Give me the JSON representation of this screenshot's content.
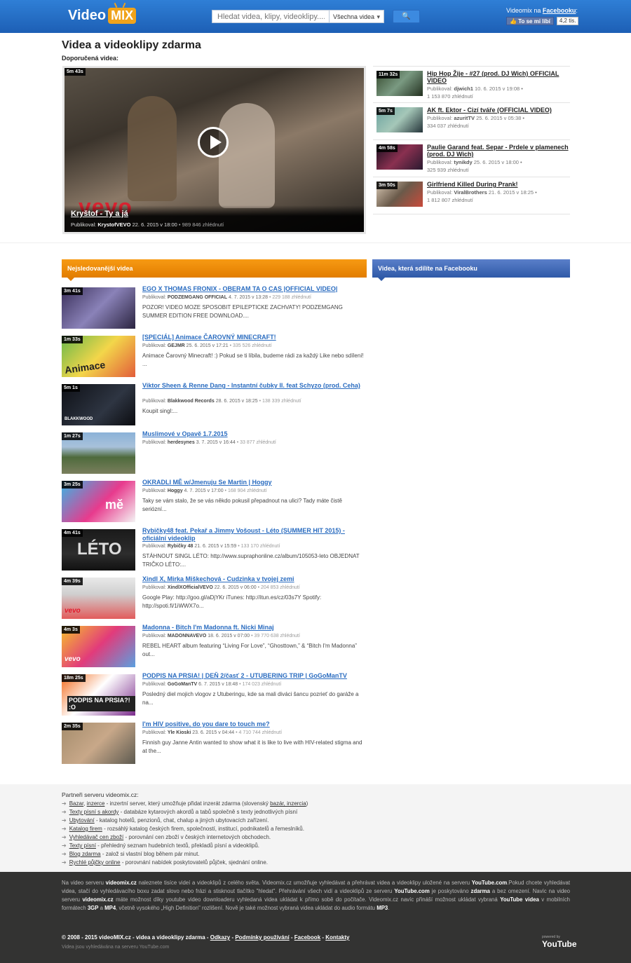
{
  "header": {
    "logo_video": "Video",
    "logo_mix": "MIX",
    "search_placeholder": "Hledat videa, klipy, videoklipy....",
    "search_select": "Všechna videa",
    "fb_text": "Videomix na",
    "fb_link": "Facebooku",
    "fb_colon": ":",
    "fb_like": "To se mi líbí",
    "fb_count": "4,2 tis."
  },
  "page": {
    "title": "Videa a videoklipy zdarma",
    "recommended": "Doporučená videa:"
  },
  "featured": {
    "duration": "5m 43s",
    "title": "Kryštof - Ty a já",
    "published_label": "Publikoval:",
    "author": "KrystofVEVO",
    "date": "22. 6. 2015 v 18:00",
    "views": "989 846 zhlédnutí",
    "overlay": "vevo"
  },
  "side_videos": [
    {
      "duration": "11m 32s",
      "title": "Hip Hop Žije - #27 (prod. DJ Wich) OFFICIAL VIDEO",
      "published_label": "Publikoval:",
      "author": "djwich1",
      "date": "10. 6. 2015 v 19:08",
      "views": "1 153 870 zhlédnutí"
    },
    {
      "duration": "5m 7s",
      "title": "AK ft. Ektor - Cizí tváře (OFFICIAL VIDEO)",
      "published_label": "Publikoval:",
      "author": "azuritTV",
      "date": "25. 6. 2015 v 05:38",
      "views": "334 037 zhlédnutí"
    },
    {
      "duration": "4m 58s",
      "title": "Paulie Garand feat. Separ - Prdele v plamenech (prod. DJ Wich)",
      "published_label": "Publikoval:",
      "author": "tynikdy",
      "date": "25. 6. 2015 v 18:00",
      "views": "325 939 zhlédnutí"
    },
    {
      "duration": "3m 50s",
      "title": "Girlfriend Killed During Prank!",
      "published_label": "Publikoval:",
      "author": "ViralBrothers",
      "date": "21. 6. 2015 v 18:25",
      "views": "1 812 807 zhlédnutí"
    }
  ],
  "sections": {
    "most_watched": "Nejsledovanější videa",
    "facebook": "Videa, která sdílíte na Facebooku"
  },
  "videos": [
    {
      "duration": "3m 41s",
      "title": "EGO X THOMAS FRONIX - OBERAM TA O CAS |OFFICIAL VIDEO|",
      "published_label": "Publikoval:",
      "author": "PODZEMGANG OFFICIAL",
      "date": "4. 7. 2015 v 13:28",
      "views": "229 188 zhlédnutí",
      "desc": "POZOR! VIDEO MOZE SPOSOBIT EPILEPTICKE ZACHVATY! PODZEMGANG SUMMER EDITION FREE DOWNLOAD....",
      "thumb_label": ""
    },
    {
      "duration": "1m 33s",
      "title": "[SPECIÁL] Animace ČAROVNÝ MINECRAFT!",
      "published_label": "Publikoval:",
      "author": "GEJMR",
      "date": "25. 6. 2015 v 17:21",
      "views": "335 526 zhlédnutí",
      "desc": "Animace Čarovný Minecraft! :) Pokud se ti líbila, budeme rádi za každý Like nebo sdílení! ...",
      "thumb_label": "Animace"
    },
    {
      "duration": "5m 1s",
      "title": "Viktor Sheen & Renne Dang - Instantní čubky II. feat Schyzo (prod. Ceha)",
      "published_label": "Publikoval:",
      "author": "Blakkwood Records",
      "date": "28. 6. 2015 v 18:25",
      "views": "138 339 zhlédnutí",
      "desc": "Koupit singl:...",
      "thumb_label": "BLAKKWOOD"
    },
    {
      "duration": "1m 27s",
      "title": "Muslimové v Opavě 1.7.2015",
      "published_label": "Publikoval:",
      "author": "herdesynes",
      "date": "3. 7. 2015 v 16:44",
      "views": "33 877 zhlédnutí",
      "desc": "",
      "thumb_label": ""
    },
    {
      "duration": "3m 25s",
      "title": "OKRADLI MĚ w/Jmenuju Se Martin | Hoggy",
      "published_label": "Publikoval:",
      "author": "Hoggy",
      "date": "4. 7. 2015 v 17:00",
      "views": "168 904 zhlédnutí",
      "desc": "Taky se vám stalo, že se vás někdo pokusil přepadnout na ulici? Tady máte čistě seriózní...",
      "thumb_label": "mě"
    },
    {
      "duration": "4m 41s",
      "title": "Rybičky48 feat. Pekař a Jimmy Vošoust - Léto (SUMMER HIT 2015) - oficiální videoklip",
      "published_label": "Publikoval:",
      "author": "Rybičky 48",
      "date": "21. 6. 2015 v 15:59",
      "views": "133 170 zhlédnutí",
      "desc": "STÁHNOUT SINGL LÉTO: http://www.supraphonline.cz/album/105053-leto OBJEDNAT TRIČKO LÉTO:...",
      "thumb_label": "LÉTO"
    },
    {
      "duration": "4m 39s",
      "title": "Xindl X, Mirka Miškechová - Cudzinka v tvojej zemi",
      "published_label": "Publikoval:",
      "author": "XindlXOfficialVEVO",
      "date": "22. 6. 2015 v 06:00",
      "views": "204 853 zhlédnutí",
      "desc": "Google Play: http://goo.gl/aDjYKr iTunes: http://itun.es/cz/03s7Y Spotify: http://spoti.fi/1iWWX7o...",
      "thumb_label": "vevo"
    },
    {
      "duration": "4m 3s",
      "title": "Madonna - Bitch I'm Madonna ft. Nicki Minaj",
      "published_label": "Publikoval:",
      "author": "MADONNAVEVO",
      "date": "18. 6. 2015 v 07:00",
      "views": "39 770 638 zhlédnutí",
      "desc": "REBEL HEART album featuring “Living For Love”, “Ghosttown,” & “Bitch I'm Madonna” out...",
      "thumb_label": "vevo"
    },
    {
      "duration": "18m 25s",
      "title": "PODPIS NA PRSIA! | DEŇ 2/časť 2 - UTUBERING TRIP | GoGoManTV",
      "published_label": "Publikoval:",
      "author": "GoGoManTV",
      "date": "6. 7. 2015 v 18:48",
      "views": "174 023 zhlédnutí",
      "desc": "Posledný diel mojich vlogov z Utuberingu, kde sa mali diváci šancu pozrieť do garáže a na...",
      "thumb_label": "PODPIS NA PRSIA?! :O"
    },
    {
      "duration": "2m 35s",
      "title": "I'm HIV positive, do you dare to touch me?",
      "published_label": "Publikoval:",
      "author": "Yle Kioski",
      "date": "23. 6. 2015 v 04:44",
      "views": "4 710 744 zhlédnutí",
      "desc": "Finnish guy Janne Antin wanted to show what it is like to live with HIV-related stigma and at the...",
      "thumb_label": ""
    }
  ],
  "partners": {
    "title": "Partneři serveru videomix.cz:",
    "items": [
      {
        "link": "Bazar",
        "sep": ", ",
        "link2": "inzerce",
        "text": " - inzertní server, který umožňuje přidat inzerát zdarma (slovenský ",
        "link3": "bazár, inzercia",
        "text2": ")"
      },
      {
        "link": "Texty písní s akordy",
        "text": " - databáze kytarových akordů a tabů společně s texty jednotlivých písní"
      },
      {
        "link": "Ubytování",
        "text": " - katalog hotelů, penzionů, chat, chalup a jiných ubytovacích zařízení."
      },
      {
        "link": "Katalog firem",
        "text": " - rozsáhlý katalog českých firem, společností, institucí, podnikatelů a řemeslníků."
      },
      {
        "link": "Vyhledávač cen zboží",
        "text": " - porovnání cen zboží v českých internetových obchodech."
      },
      {
        "link": "Texty písní",
        "text": " - přehledný seznam hudebních textů, překladů písní a videoklipů."
      },
      {
        "link": "Blog zdarma",
        "text": " - založ si vlastní blog během pár minut."
      },
      {
        "link": "Rychlé půjčky online",
        "text": " - porovnání nabídek poskytovatelů půjček, sjednání online."
      }
    ]
  },
  "footer": {
    "desc_1": "Na video serveru ",
    "desc_b1": "videomix.cz",
    "desc_2": " naleznete tisíce videí a videoklipů z celého světa. Videomix.cz umožňuje vyhledávat a přehrávat videa a videoklipy uložené na serveru ",
    "desc_b2": "YouTube.com",
    "desc_3": ".Pokud chcete vyhledávat videa, stačí do vyhledávacího boxu zadat slovo nebo frázi a stisknout tlačítko \"hledat\". Přehrávání všech vidí a videoklipů ze serveru ",
    "desc_b3": "YouTube.com",
    "desc_4": " je poskytováno ",
    "desc_b4": "zdarma",
    "desc_5": " a bez omezení. Navíc na video serveru ",
    "desc_b5": "videomix.cz",
    "desc_6": " máte možnost díky youtube video downloaderu vyhledaná videa ukládat k přímo sobě do počítače. Videomix.cz navíc přináší možnost ukládat vybraná ",
    "desc_b6": "YouTube videa",
    "desc_7": " v mobilních formátech ",
    "desc_b7": "3GP",
    "desc_8": " a ",
    "desc_b8": "MP4",
    "desc_9": ", včetně vysokého „High Definition\" rozlišení. Nově je také možnost vybraná videa ukládat do audio formátu ",
    "desc_b9": "MP3",
    "desc_10": ".",
    "copyright": "© 2008 - 2015 videoMIX.cz - videa a videoklipy zdarma - ",
    "links": [
      "Odkazy",
      "Podmínky používání",
      "Facebook",
      "Kontakty"
    ],
    "note": "Videa jsou vyhledávána na serveru YouTube.com",
    "powered": "powered by",
    "youtube": "YouTube"
  }
}
